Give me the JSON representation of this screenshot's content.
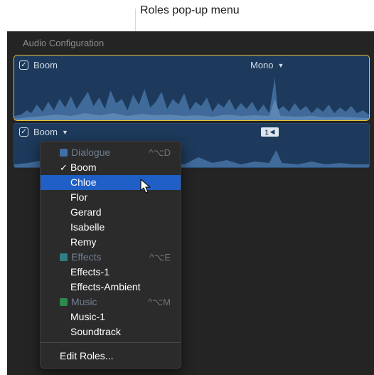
{
  "callout": {
    "label": "Roles pop-up menu"
  },
  "panel": {
    "title": "Audio Configuration"
  },
  "clips": [
    {
      "name": "Boom",
      "checked": true,
      "channel_label": "Mono"
    },
    {
      "name": "Boom",
      "checked": true,
      "channel_badge": "1"
    }
  ],
  "menu": {
    "items": [
      {
        "type": "header",
        "label": "Dialogue",
        "color": "#3f6fa6",
        "shortcut": "^⌥D"
      },
      {
        "type": "item",
        "label": "Boom",
        "checked": true
      },
      {
        "type": "item",
        "label": "Chloe",
        "selected": true
      },
      {
        "type": "item",
        "label": "Flor"
      },
      {
        "type": "item",
        "label": "Gerard"
      },
      {
        "type": "item",
        "label": "Isabelle"
      },
      {
        "type": "item",
        "label": "Remy"
      },
      {
        "type": "header",
        "label": "Effects",
        "color": "#2f7e86",
        "shortcut": "^⌥E"
      },
      {
        "type": "item",
        "label": "Effects-1"
      },
      {
        "type": "item",
        "label": "Effects-Ambient"
      },
      {
        "type": "header",
        "label": "Music",
        "color": "#2e8a4c",
        "shortcut": "^⌥M"
      },
      {
        "type": "item",
        "label": "Music-1"
      },
      {
        "type": "item",
        "label": "Soundtrack"
      }
    ],
    "footer": {
      "label": "Edit Roles..."
    }
  },
  "colors": {
    "accent_selected": "#1f5fc6",
    "clip_selected_border": "#e8c02f",
    "clip_fill": "#1d3a5c"
  }
}
